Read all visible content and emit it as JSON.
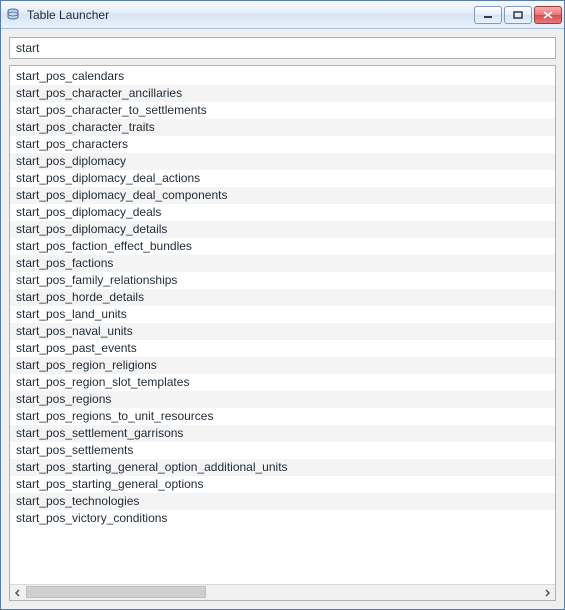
{
  "window": {
    "title": "Table Launcher"
  },
  "search": {
    "value": "start"
  },
  "list": {
    "items": [
      "start_pos_calendars",
      "start_pos_character_ancillaries",
      "start_pos_character_to_settlements",
      "start_pos_character_traits",
      "start_pos_characters",
      "start_pos_diplomacy",
      "start_pos_diplomacy_deal_actions",
      "start_pos_diplomacy_deal_components",
      "start_pos_diplomacy_deals",
      "start_pos_diplomacy_details",
      "start_pos_faction_effect_bundles",
      "start_pos_factions",
      "start_pos_family_relationships",
      "start_pos_horde_details",
      "start_pos_land_units",
      "start_pos_naval_units",
      "start_pos_past_events",
      "start_pos_region_religions",
      "start_pos_region_slot_templates",
      "start_pos_regions",
      "start_pos_regions_to_unit_resources",
      "start_pos_settlement_garrisons",
      "start_pos_settlements",
      "start_pos_starting_general_option_additional_units",
      "start_pos_starting_general_options",
      "start_pos_technologies",
      "start_pos_victory_conditions"
    ]
  }
}
